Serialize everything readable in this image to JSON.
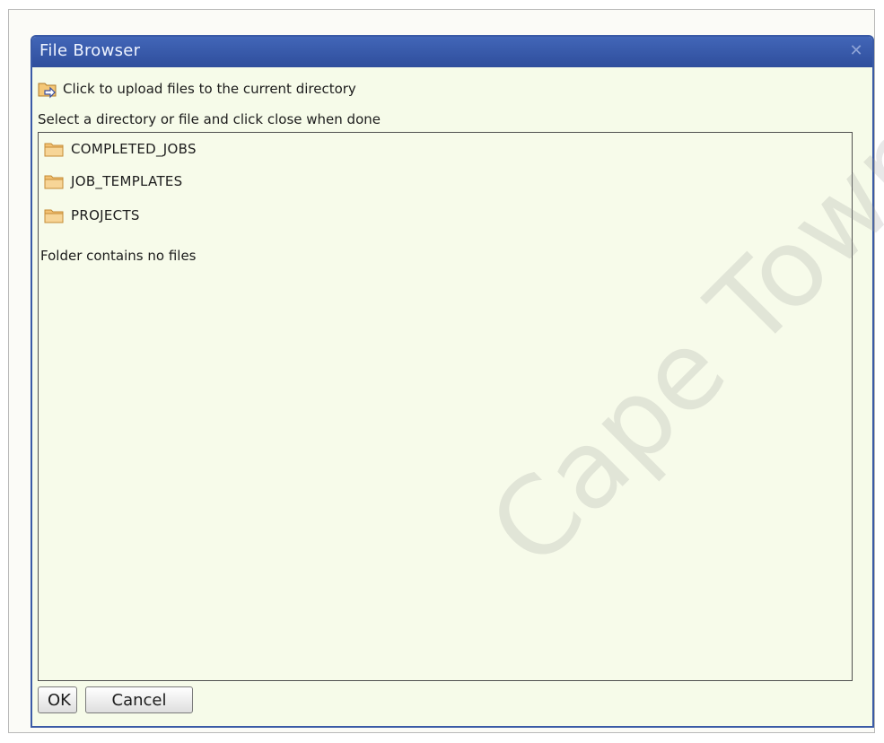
{
  "dialog": {
    "title": "File Browser",
    "close_icon": "close-icon",
    "upload_text": "Click to upload files to the current directory",
    "upload_icon": "upload-folder-icon",
    "instruction": "Select a directory or file and click close when done",
    "folders": [
      {
        "label": "COMPLETED_JOBS",
        "icon": "folder-icon"
      },
      {
        "label": "JOB_TEMPLATES",
        "icon": "folder-icon"
      },
      {
        "label": "PROJECTS",
        "icon": "folder-icon"
      }
    ],
    "empty_note": "Folder contains no files",
    "ok_label": "OK",
    "cancel_label": "Cancel"
  },
  "watermark": "Cape Town",
  "colors": {
    "title_bar": "#3a5aa6",
    "dialog_bg": "#f6fbe9",
    "folder": "#f2b85a"
  }
}
